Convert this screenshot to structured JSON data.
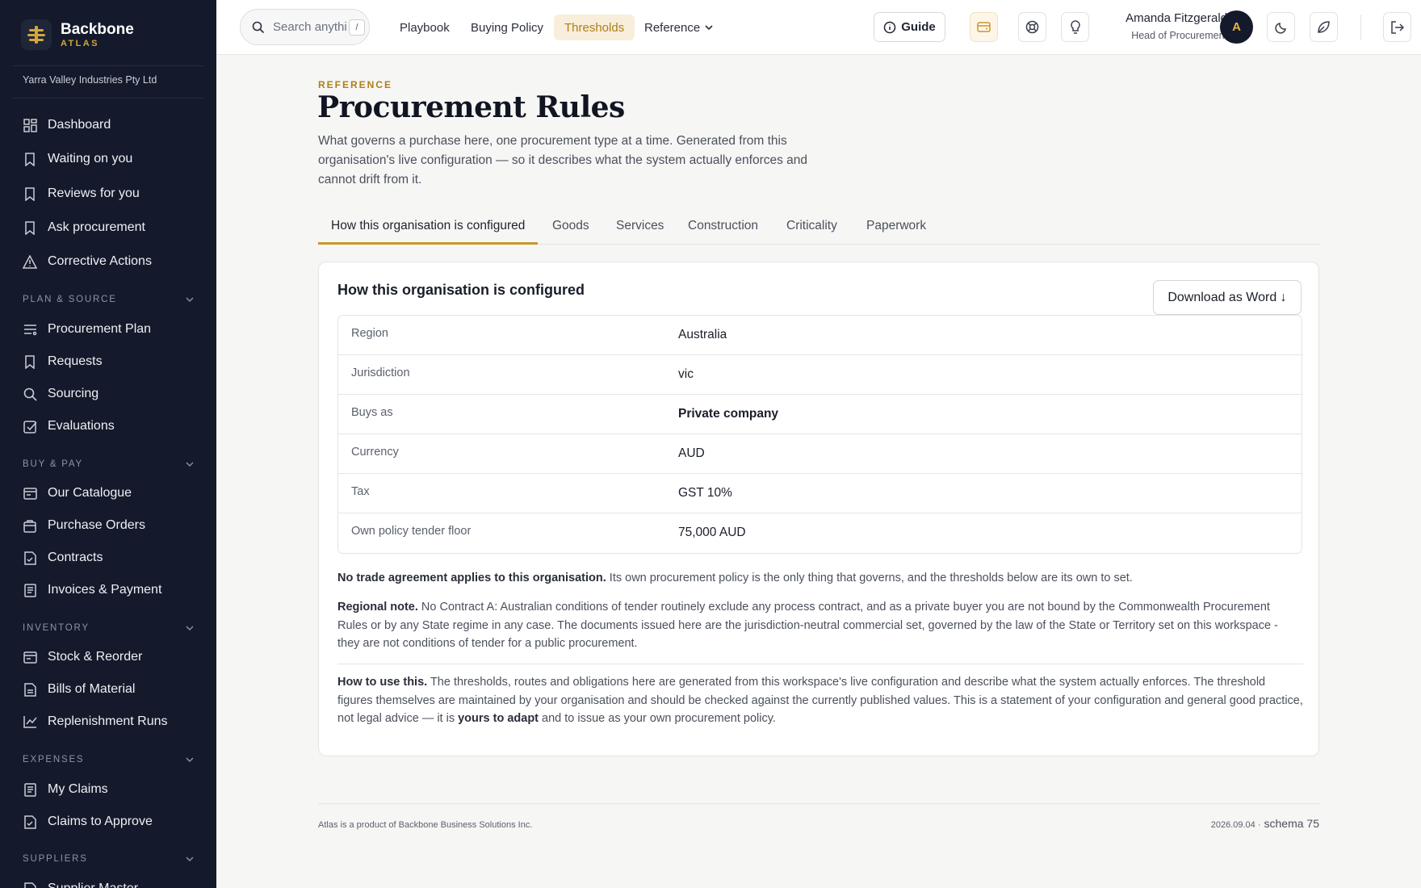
{
  "brand": {
    "name": "Backbone",
    "subtitle": "ATLAS"
  },
  "sidebar": {
    "org": "Yarra Valley Industries Pty Ltd",
    "top_items": [
      {
        "label": "Dashboard",
        "icon": "grid-icon"
      },
      {
        "label": "Waiting on you",
        "icon": "bookmark-icon"
      },
      {
        "label": "Reviews for you",
        "icon": "bookmark-icon"
      },
      {
        "label": "Ask procurement",
        "icon": "bookmark-icon"
      },
      {
        "label": "Corrective Actions",
        "icon": "warning-icon"
      }
    ],
    "sections": [
      {
        "title": "PLAN & SOURCE",
        "items": [
          {
            "label": "Procurement Plan",
            "icon": "list-icon"
          },
          {
            "label": "Requests",
            "icon": "bookmark-icon"
          },
          {
            "label": "Sourcing",
            "icon": "search-icon"
          },
          {
            "label": "Evaluations",
            "icon": "checkbox-icon"
          }
        ]
      },
      {
        "title": "BUY & PAY",
        "items": [
          {
            "label": "Our Catalogue",
            "icon": "card-icon"
          },
          {
            "label": "Purchase Orders",
            "icon": "bag-icon"
          },
          {
            "label": "Contracts",
            "icon": "file-check-icon"
          },
          {
            "label": "Invoices & Payment",
            "icon": "receipt-icon"
          }
        ]
      },
      {
        "title": "INVENTORY",
        "items": [
          {
            "label": "Stock & Reorder",
            "icon": "card-icon"
          },
          {
            "label": "Bills of Material",
            "icon": "file-icon"
          },
          {
            "label": "Replenishment Runs",
            "icon": "chart-line-icon"
          }
        ]
      },
      {
        "title": "EXPENSES",
        "items": [
          {
            "label": "My Claims",
            "icon": "receipt-icon"
          },
          {
            "label": "Claims to Approve",
            "icon": "file-check-icon"
          }
        ]
      },
      {
        "title": "SUPPLIERS",
        "items": [
          {
            "label": "Supplier Master",
            "icon": "file-icon"
          }
        ]
      }
    ]
  },
  "header": {
    "search_placeholder": "Search anything",
    "search_shortcut": "/",
    "nav": [
      "Playbook",
      "Buying Policy",
      "Thresholds",
      "Reference"
    ],
    "active_nav": "Thresholds",
    "guide_label": "Guide",
    "user_name": "Amanda Fitzgerald",
    "user_role": "Head of Procurement",
    "avatar_initial": "A"
  },
  "page": {
    "eyebrow": "REFERENCE",
    "title": "Procurement Rules",
    "description": "What governs a purchase here, one procurement type at a time. Generated from this organisation's live configuration — so it describes what the system actually enforces and cannot drift from it.",
    "tabs": [
      "How this organisation is configured",
      "Goods",
      "Services",
      "Construction",
      "Criticality",
      "Paperwork"
    ],
    "active_tab": 0
  },
  "card": {
    "title": "How this organisation is configured",
    "download_label": "Download as Word ↓",
    "rows": [
      {
        "label": "Region",
        "value": "Australia"
      },
      {
        "label": "Jurisdiction",
        "value": "vic"
      },
      {
        "label": "Buys as",
        "value": "Private company"
      },
      {
        "label": "Currency",
        "value": "AUD"
      },
      {
        "label": "Tax",
        "value": "GST 10%"
      },
      {
        "label": "Own policy tender floor",
        "value": "75,000 AUD"
      }
    ],
    "note1_bold": "No trade agreement applies to this organisation.",
    "note1_text": " Its own procurement policy is the only thing that governs, and the thresholds below are its own to set.",
    "note2_bold": "Regional note.",
    "note2_text": " No Contract A: Australian conditions of tender routinely exclude any process contract, and as a private buyer you are not bound by the Commonwealth Procurement Rules or by any State regime in any case. The documents issued here are the jurisdiction-neutral commercial set, governed by the law of the State or Territory set on this workspace - they are not conditions of tender for a public procurement.",
    "note3_bold": "How to use this.",
    "note3_text": " The thresholds, routes and obligations here are generated from this workspace's live configuration and describe what the system actually enforces. The threshold figures themselves are maintained by your organisation and should be checked against the currently published values. This is a statement of your configuration and general good practice, not legal advice — it is ",
    "note3_bold2": "yours to adapt",
    "note3_tail": " and to issue as your own procurement policy."
  },
  "footer": {
    "left": "Atlas is a product of Backbone Business Solutions Inc.",
    "version": "2026.09.04 ·",
    "schema": "schema 75"
  },
  "colors": {
    "sidebar_bg": "#141a2b",
    "accent_gold": "#c9962e",
    "active_nav_bg": "#f8eedb"
  }
}
